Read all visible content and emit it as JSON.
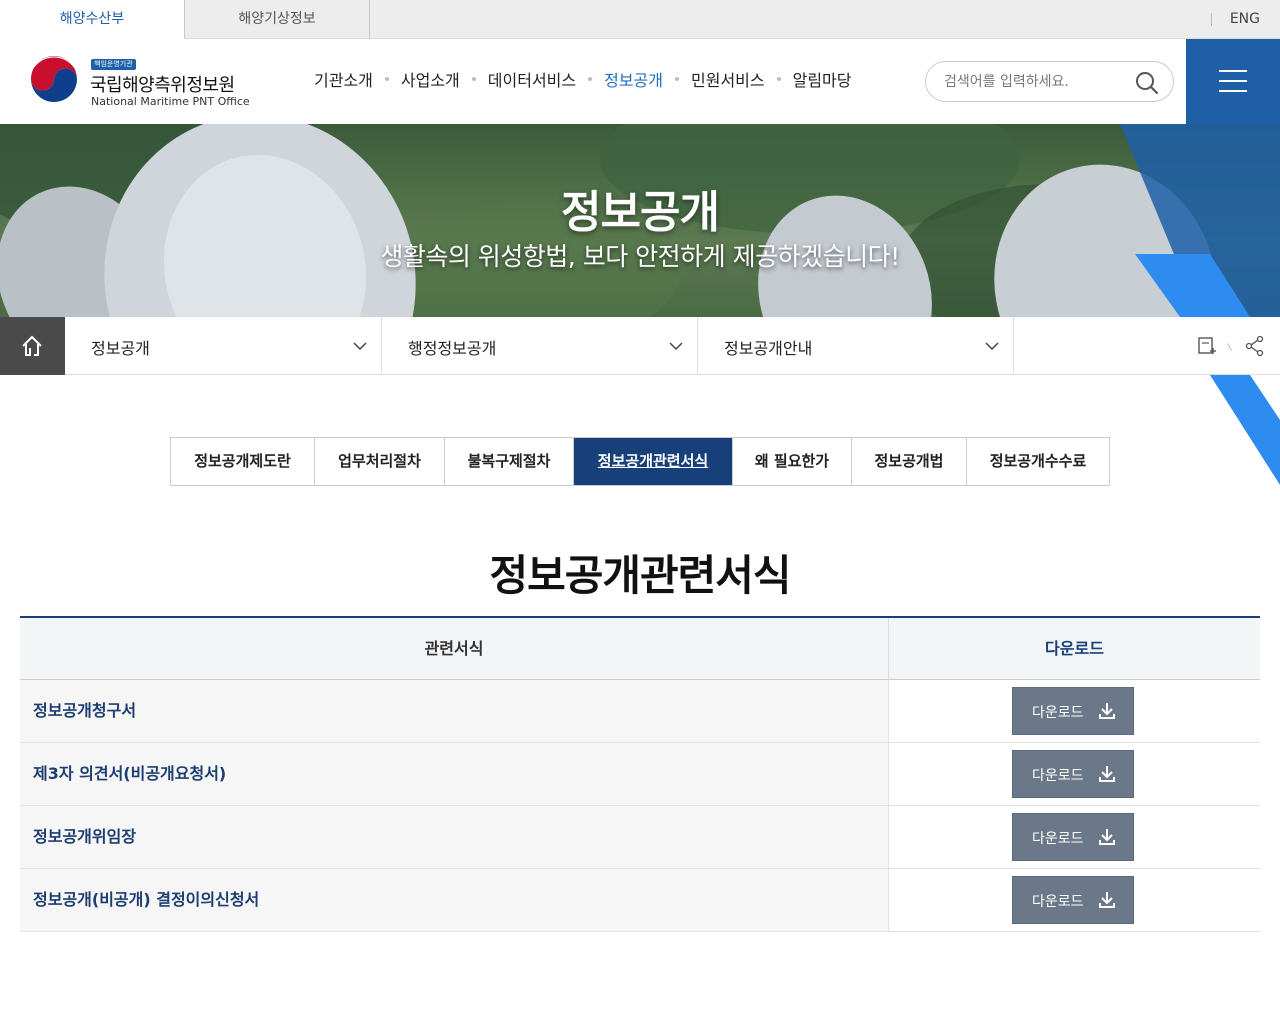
{
  "util_tabs": [
    "해양수산부",
    "해양기상정보"
  ],
  "lang": "ENG",
  "logo": {
    "badge": "책임운영기관",
    "name_ko": "국립해양측위정보원",
    "name_en": "National Maritime PNT Office"
  },
  "gnb": [
    {
      "label": "기관소개"
    },
    {
      "label": "사업소개"
    },
    {
      "label": "데이터서비스"
    },
    {
      "label": "정보공개",
      "active": true
    },
    {
      "label": "민원서비스"
    },
    {
      "label": "알림마당"
    }
  ],
  "search": {
    "placeholder": "검색어를 입력하세요."
  },
  "hero": {
    "title": "정보공개",
    "subtitle": "생활속의 위성항법, 보다 안전하게 제공하겠습니다!"
  },
  "location": [
    "정보공개",
    "행정정보공개",
    "정보공개안내"
  ],
  "tabs": [
    {
      "label": "정보공개제도란"
    },
    {
      "label": "업무처리절차"
    },
    {
      "label": "불복구제절차"
    },
    {
      "label": "정보공개관련서식",
      "active": true
    },
    {
      "label": "왜 필요한가"
    },
    {
      "label": "정보공개법"
    },
    {
      "label": "정보공개수수료"
    }
  ],
  "page_title": "정보공개관련서식",
  "table": {
    "headers": [
      "관련서식",
      "다운로드"
    ],
    "rows": [
      {
        "name": "정보공개청구서",
        "button": "다운로드"
      },
      {
        "name": "제3자 의견서(비공개요청서)",
        "button": "다운로드"
      },
      {
        "name": "정보공개위임장",
        "button": "다운로드"
      },
      {
        "name": "정보공개(비공개) 결정이의신청서",
        "button": "다운로드"
      }
    ]
  },
  "colors": {
    "primary": "#1f5fa8",
    "navy": "#173f7a",
    "button": "#6b7889"
  },
  "icons": [
    "search-icon",
    "menu-icon",
    "home-icon",
    "chevron-down-icon",
    "print-icon",
    "share-icon",
    "download-icon",
    "government-emblem-icon"
  ]
}
